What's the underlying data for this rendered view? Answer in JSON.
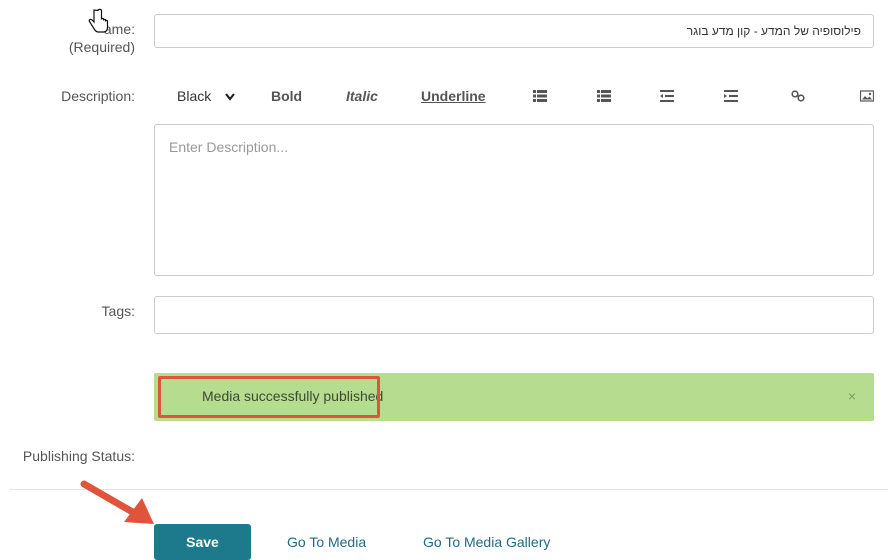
{
  "form": {
    "name_label": "Name:",
    "name_label_visible": "ame:",
    "required_label": "(Required)",
    "name_value": "פילוסופיה של המדע - קון מדע בוגר",
    "description_label": "Description:",
    "description_placeholder": "Enter Description...",
    "tags_label": "Tags:",
    "publishing_status_label": "Publishing Status:"
  },
  "toolbar": {
    "color_label": "Black",
    "bold_label": "Bold",
    "italic_label": "Italic",
    "underline_label": "Underline",
    "icons": [
      "bullet-list-icon",
      "numbered-list-icon",
      "outdent-icon",
      "indent-icon",
      "link-icon",
      "image-icon"
    ]
  },
  "alert": {
    "message": "Media successfully published",
    "close": "×",
    "background": "#b5dc8f"
  },
  "actions": {
    "save_label": "Save",
    "go_to_media_label": "Go To Media",
    "go_to_gallery_label": "Go To Media Gallery"
  },
  "colors": {
    "accent": "#1d7a8c",
    "annotation": "#e0543b"
  }
}
